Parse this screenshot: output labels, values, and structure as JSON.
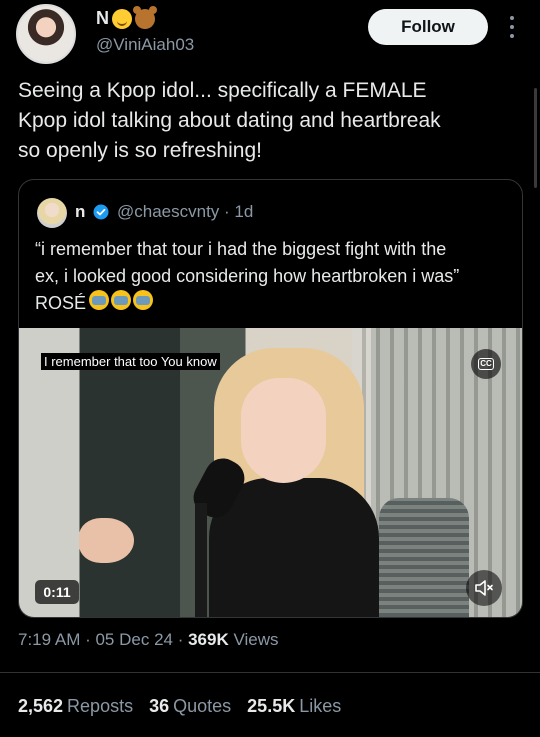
{
  "author": {
    "display_name": "N",
    "handle": "@ViniAiah03",
    "follow_label": "Follow"
  },
  "tweet": {
    "text": "Seeing a Kpop idol... specifically a FEMALE\nKpop idol talking about dating and heartbreak\nso openly is so refreshing!"
  },
  "quote": {
    "name": "n",
    "meta": "@chaescvnty · 1d",
    "text": "“i remember that tour i had the biggest fight with the\nex, i looked good considering how heartbroken i was”\nROSÉ"
  },
  "video": {
    "caption": "I remember that too You know",
    "cc_label": "CC",
    "duration": "0:11"
  },
  "meta": {
    "time_date": "7:19 AM · 05 Dec 24 · ",
    "views_count": "369K",
    "views_label": " Views"
  },
  "stats": {
    "reposts_count": "2,562",
    "reposts_label": "Reposts",
    "quotes_count": "36",
    "quotes_label": "Quotes",
    "likes_count": "25.5K",
    "likes_label": "Likes"
  },
  "colors": {
    "background": "#000000",
    "text": "#e7e9ea",
    "secondary_text": "#8b98a5",
    "verified": "#1d9bf0"
  }
}
